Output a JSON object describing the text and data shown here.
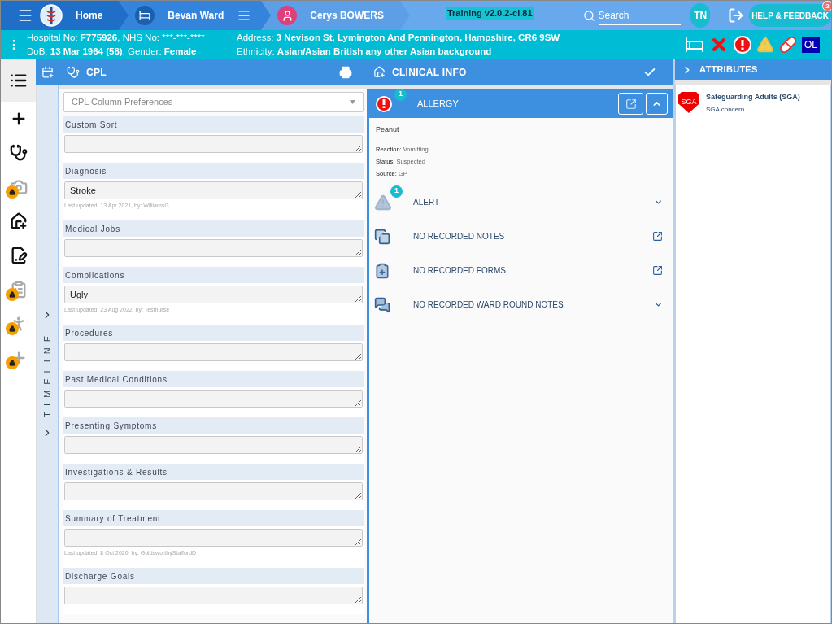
{
  "topbar": {
    "breadcrumbs": [
      {
        "label": "Home",
        "kind": "home"
      },
      {
        "label": "Bevan Ward",
        "kind": "ward"
      },
      {
        "label": "Cerys BOWERS",
        "kind": "patient"
      }
    ],
    "environment": "Training v2.0.2-ci.81",
    "search": {
      "placeholder": "Search"
    },
    "user_initials": "TN",
    "help_button": {
      "label": "HELP & FEEDBACK",
      "badge": "2"
    }
  },
  "patient_banner": {
    "columns": [
      [
        [
          {
            "text": "Hospital No: ",
            "bold": false
          },
          {
            "text": "F775926",
            "bold": true
          },
          {
            "text": ", NHS No: ***-***-****",
            "bold": false
          }
        ],
        [
          {
            "text": "DoB: ",
            "bold": false
          },
          {
            "text": "13 Mar 1964 (58)",
            "bold": true
          },
          {
            "text": ", Gender: ",
            "bold": false
          },
          {
            "text": "Female",
            "bold": true
          }
        ]
      ],
      [
        [
          {
            "text": "Address: ",
            "bold": false
          },
          {
            "text": "3 Nevison St, Lymington And Pennington, Hampshire, CR6 9SW",
            "bold": true
          }
        ],
        [
          {
            "text": "Ethnicity: ",
            "bold": false
          },
          {
            "text": "Asian/Asian British any other Asian background",
            "bold": true
          }
        ]
      ]
    ],
    "flags": [
      {
        "kind": "bed"
      },
      {
        "kind": "cross"
      },
      {
        "kind": "allergy"
      },
      {
        "kind": "warning"
      },
      {
        "kind": "pill"
      },
      {
        "kind": "text",
        "label": "OL"
      }
    ]
  },
  "sidebar": {
    "items": [
      {
        "selected": true,
        "locked": false
      },
      {
        "selected": false,
        "locked": false
      },
      {
        "selected": false,
        "locked": false
      },
      {
        "selected": false,
        "locked": true
      },
      {
        "selected": false,
        "locked": false
      },
      {
        "selected": false,
        "locked": false
      },
      {
        "selected": false,
        "locked": true
      },
      {
        "selected": false,
        "locked": true
      },
      {
        "selected": false,
        "locked": true
      }
    ]
  },
  "timeline": {
    "label": "TIMELINE"
  },
  "cpl": {
    "title": "CPL",
    "column_preferences": {
      "placeholder": "CPL Column Preferences"
    },
    "sections": [
      {
        "label": "Custom Sort"
      },
      {
        "label": "Diagnosis",
        "value": "Stroke",
        "updated": "Last updated: 13 Apr 2021, by: WilliamsG"
      },
      {
        "label": "Medical Jobs"
      },
      {
        "label": "Complications",
        "value": "Ugly",
        "updated": "Last updated: 23 Aug 2022, by: Testnurse"
      },
      {
        "label": "Procedures"
      },
      {
        "label": "Past Medical Conditions"
      },
      {
        "label": "Presenting Symptoms"
      },
      {
        "label": "Investigations & Results"
      },
      {
        "label": "Summary of Treatment",
        "updated": "Last updated: 8 Oct 2020, by: GoldsworthyStaffordD"
      },
      {
        "label": "Discharge Goals"
      }
    ]
  },
  "clinical_info": {
    "title": "CLINICAL INFO",
    "allergy": {
      "title": "ALLERGY",
      "count": "1",
      "expanded": true,
      "name": "Peanut",
      "details": [
        {
          "label": "Reaction: ",
          "value": "Vomitting"
        },
        {
          "label": "Status: ",
          "value": "Suspected"
        },
        {
          "label": "Source: ",
          "value": "GP"
        }
      ]
    },
    "sections": [
      {
        "title": "ALERT",
        "count": "1",
        "kind": "alert"
      },
      {
        "title": "NO RECORDED NOTES",
        "kind": "notes"
      },
      {
        "title": "NO RECORDED FORMS",
        "kind": "forms"
      },
      {
        "title": "NO RECORDED WARD ROUND NOTES",
        "kind": "ward_round"
      }
    ]
  },
  "attributes": {
    "title": "ATTRIBUTES",
    "items": [
      {
        "badge": "SGA",
        "title": "Safeguarding Adults (SGA)",
        "subtitle": "SGA concern"
      }
    ]
  }
}
